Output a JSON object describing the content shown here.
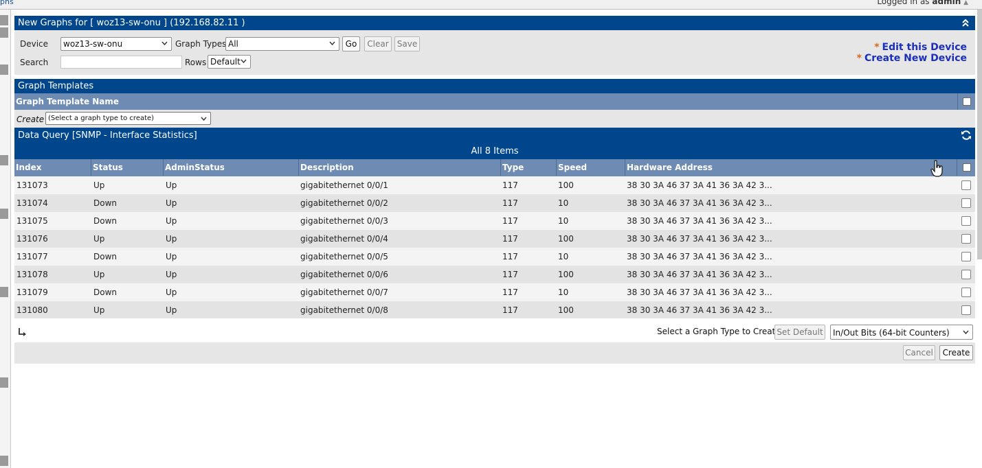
{
  "top": {
    "left_link": "phs",
    "logged_in_prefix": "Logged in as",
    "logged_in_user": "admin"
  },
  "header": {
    "title": "New Graphs for [ woz13-sw-onu ] (192.168.82.11 )"
  },
  "filters": {
    "device_label": "Device",
    "device_value": "woz13-sw-onu",
    "graph_types_label": "Graph Types",
    "graph_types_value": "All",
    "go": "Go",
    "clear": "Clear",
    "save": "Save",
    "search_label": "Search",
    "search_value": "",
    "rows_label": "Rows",
    "rows_value": "Default",
    "edit_device": "Edit this Device",
    "create_device": "Create New Device",
    "star": "*"
  },
  "graph_templates": {
    "title": "Graph Templates",
    "column": "Graph Template Name",
    "create_label": "Create",
    "create_select": "(Select a graph type to create)"
  },
  "data_query": {
    "title": "Data Query [SNMP - Interface Statistics]",
    "items_summary": "All 8 Items",
    "columns": [
      "Index",
      "Status",
      "AdminStatus",
      "Description",
      "Type",
      "Speed",
      "Hardware Address"
    ],
    "rows": [
      {
        "index": "131073",
        "status": "Up",
        "admin": "Up",
        "desc": "gigabitethernet 0/0/1",
        "type": "117",
        "speed": "100",
        "hw": "38 30 3A 46 37 3A 41 36 3A 42 3..."
      },
      {
        "index": "131074",
        "status": "Down",
        "admin": "Up",
        "desc": "gigabitethernet 0/0/2",
        "type": "117",
        "speed": "10",
        "hw": "38 30 3A 46 37 3A 41 36 3A 42 3..."
      },
      {
        "index": "131075",
        "status": "Down",
        "admin": "Up",
        "desc": "gigabitethernet 0/0/3",
        "type": "117",
        "speed": "10",
        "hw": "38 30 3A 46 37 3A 41 36 3A 42 3..."
      },
      {
        "index": "131076",
        "status": "Up",
        "admin": "Up",
        "desc": "gigabitethernet 0/0/4",
        "type": "117",
        "speed": "100",
        "hw": "38 30 3A 46 37 3A 41 36 3A 42 3..."
      },
      {
        "index": "131077",
        "status": "Down",
        "admin": "Up",
        "desc": "gigabitethernet 0/0/5",
        "type": "117",
        "speed": "10",
        "hw": "38 30 3A 46 37 3A 41 36 3A 42 3..."
      },
      {
        "index": "131078",
        "status": "Up",
        "admin": "Up",
        "desc": "gigabitethernet 0/0/6",
        "type": "117",
        "speed": "100",
        "hw": "38 30 3A 46 37 3A 41 36 3A 42 3..."
      },
      {
        "index": "131079",
        "status": "Down",
        "admin": "Up",
        "desc": "gigabitethernet 0/0/7",
        "type": "117",
        "speed": "10",
        "hw": "38 30 3A 46 37 3A 41 36 3A 42 3..."
      },
      {
        "index": "131080",
        "status": "Up",
        "admin": "Up",
        "desc": "gigabitethernet 0/0/8",
        "type": "117",
        "speed": "100",
        "hw": "38 30 3A 46 37 3A 41 36 3A 42 3..."
      }
    ],
    "select_type_label": "Select a Graph Type to Create",
    "set_default": "Set Default",
    "graph_type_value": "In/Out Bits (64-bit Counters)"
  },
  "footer": {
    "cancel": "Cancel",
    "create": "Create"
  },
  "icons": {
    "collapse": "double-chevron-up-icon",
    "reload": "reload-icon",
    "enter_arrow": "enter-arrow-icon",
    "pointer": "hand-pointer-icon"
  },
  "colors": {
    "header_blue": "#00468c",
    "subheader_blue": "#6d8bb3",
    "link_blue": "#1b2fbf",
    "star_orange": "#d66a1a"
  }
}
